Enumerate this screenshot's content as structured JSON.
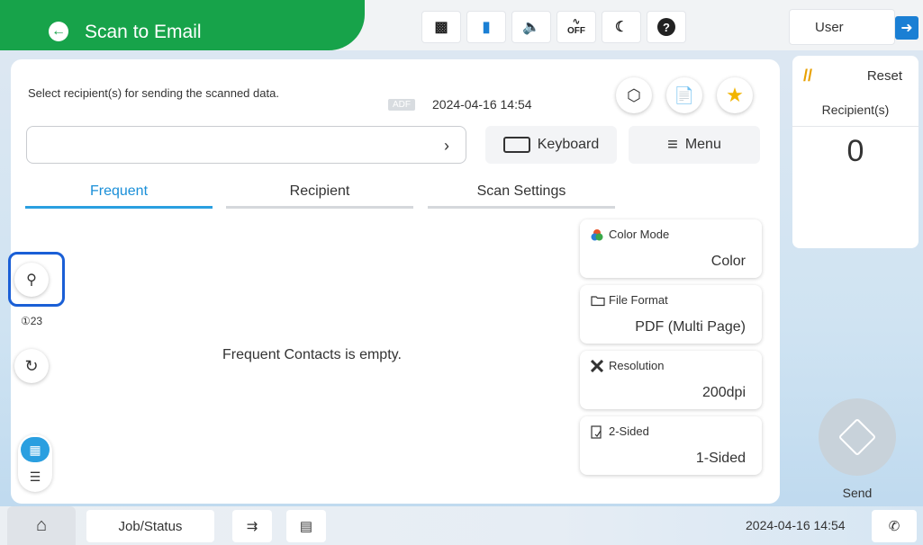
{
  "header": {
    "title": "Scan to Email",
    "status_icons": [
      "ink-icon",
      "network-icon",
      "volume-icon",
      "quiet-mode-off-icon",
      "sleep-icon",
      "help-icon"
    ],
    "quiet_label": "OFF",
    "user_label": "User"
  },
  "main": {
    "prompt": "Select recipient(s) for sending the scanned data.",
    "adf_badge": "ADF",
    "datetime": "2024-04-16 14:54",
    "keyboard_label": "Keyboard",
    "menu_label": "Menu",
    "tabs": [
      {
        "label": "Frequent",
        "active": true
      },
      {
        "label": "Recipient",
        "active": false
      },
      {
        "label": "Scan Settings",
        "active": false
      }
    ],
    "empty_message": "Frequent Contacts is empty.",
    "number_search_label": "①23"
  },
  "settings": [
    {
      "label": "Color Mode",
      "value": "Color"
    },
    {
      "label": "File Format",
      "value": "PDF (Multi Page)"
    },
    {
      "label": "Resolution",
      "value": "200dpi"
    },
    {
      "label": "2-Sided",
      "value": "1-Sided"
    }
  ],
  "right_panel": {
    "reset_label": "Reset",
    "recipients_label": "Recipient(s)",
    "recipients_count": "0",
    "send_label": "Send"
  },
  "bottom_bar": {
    "job_status_label": "Job/Status",
    "datetime": "2024-04-16 14:54"
  },
  "colors": {
    "accent_green": "#17a34a",
    "accent_blue": "#2a9fe0",
    "highlight_border": "#1a5fd6"
  }
}
